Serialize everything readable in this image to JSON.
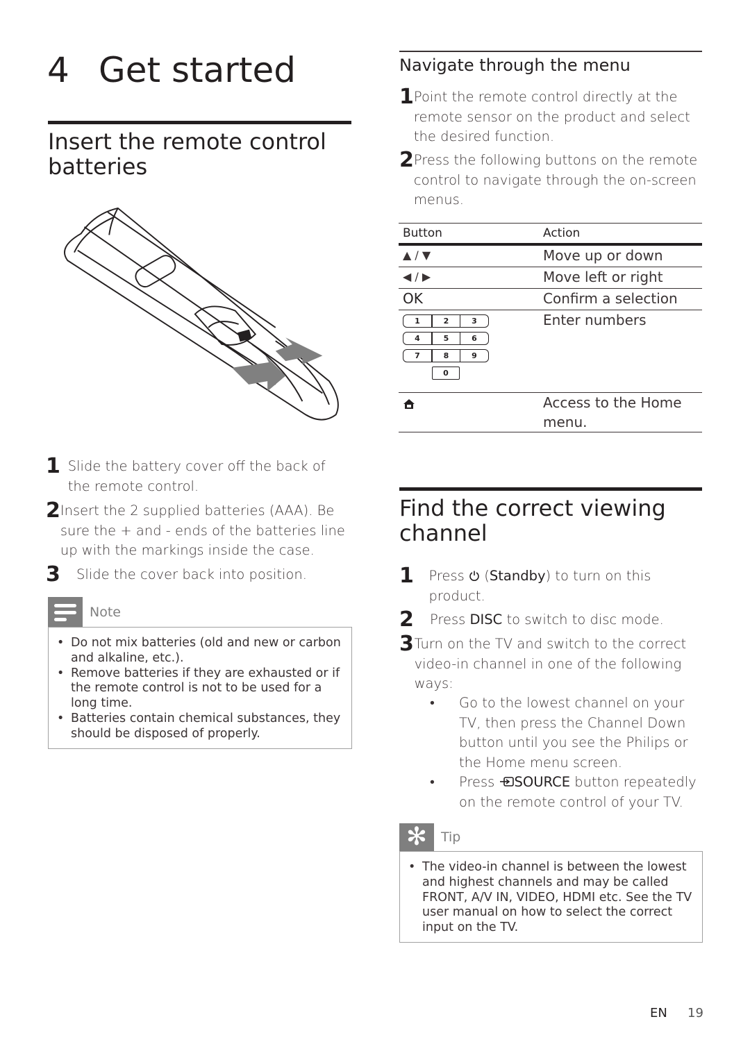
{
  "chapter": {
    "number": "4",
    "title": "Get started"
  },
  "left": {
    "section_title": "Insert the remote control batteries",
    "illustration": "remote-control-battery-illustration",
    "steps": [
      {
        "num": "1",
        "text": "Slide the battery cover off the back of the remote control."
      },
      {
        "num": "2",
        "text": "Insert the 2 supplied batteries (AAA). Be sure the + and - ends of the batteries line up with the markings inside the case."
      },
      {
        "num": "3",
        "text": "Slide the cover back into position."
      }
    ],
    "note": {
      "label": "Note",
      "icon": "note-icon",
      "items": [
        "Do not mix batteries (old and new or carbon and alkaline, etc.).",
        "Remove batteries if they are exhausted or if the remote control is not to be used for a long time.",
        "Batteries contain chemical substances, they should be disposed of properly."
      ]
    }
  },
  "right": {
    "navigate": {
      "title": "Navigate through the menu",
      "steps": [
        {
          "num": "1",
          "text": "Point the remote control directly at the remote sensor on the product and select the desired function."
        },
        {
          "num": "2",
          "text": "Press the following buttons on the remote control to navigate through the on-screen menus."
        }
      ],
      "table": {
        "headers": [
          "Button",
          "Action"
        ],
        "rows": [
          {
            "button": "▲ / ▼",
            "action": "Move up or down"
          },
          {
            "button": "◀ / ▶",
            "action": "Move left or right"
          },
          {
            "button": "OK",
            "action": "Confirm a selection"
          },
          {
            "button": "keypad",
            "action": "Enter numbers",
            "keys": [
              "1",
              "2",
              "3",
              "4",
              "5",
              "6",
              "7",
              "8",
              "9",
              "0"
            ]
          },
          {
            "button": "home-icon",
            "action": "Access to the Home menu."
          }
        ]
      }
    },
    "find_channel": {
      "title": "Find the correct viewing channel",
      "steps": [
        {
          "num": "1",
          "pre": "Press ",
          "icon": "standby-icon",
          "mid": " (",
          "bold": "Standby",
          "post": ") to turn on this product."
        },
        {
          "num": "2",
          "pre": "Press ",
          "bold": "DISC",
          "post": " to switch to disc mode."
        },
        {
          "num": "3",
          "text": "Turn on the TV and switch to the correct video-in channel in one of the following ways:"
        }
      ],
      "sub_items": [
        {
          "text": "Go to the lowest channel on your TV, then press the Channel Down button until you see the Philips or the Home menu screen."
        },
        {
          "pre": "Press ",
          "icon": "source-icon",
          "bold": "SOURCE",
          "post": " button repeatedly on the remote control of your TV."
        }
      ],
      "tip": {
        "label": "Tip",
        "icon": "tip-icon",
        "items": [
          "The video-in channel is between the lowest and highest channels and may be called FRONT, A/V IN, VIDEO, HDMI etc. See the TV user manual on how to select the correct input on the TV."
        ]
      }
    }
  },
  "footer": {
    "language": "EN",
    "page": "19"
  }
}
